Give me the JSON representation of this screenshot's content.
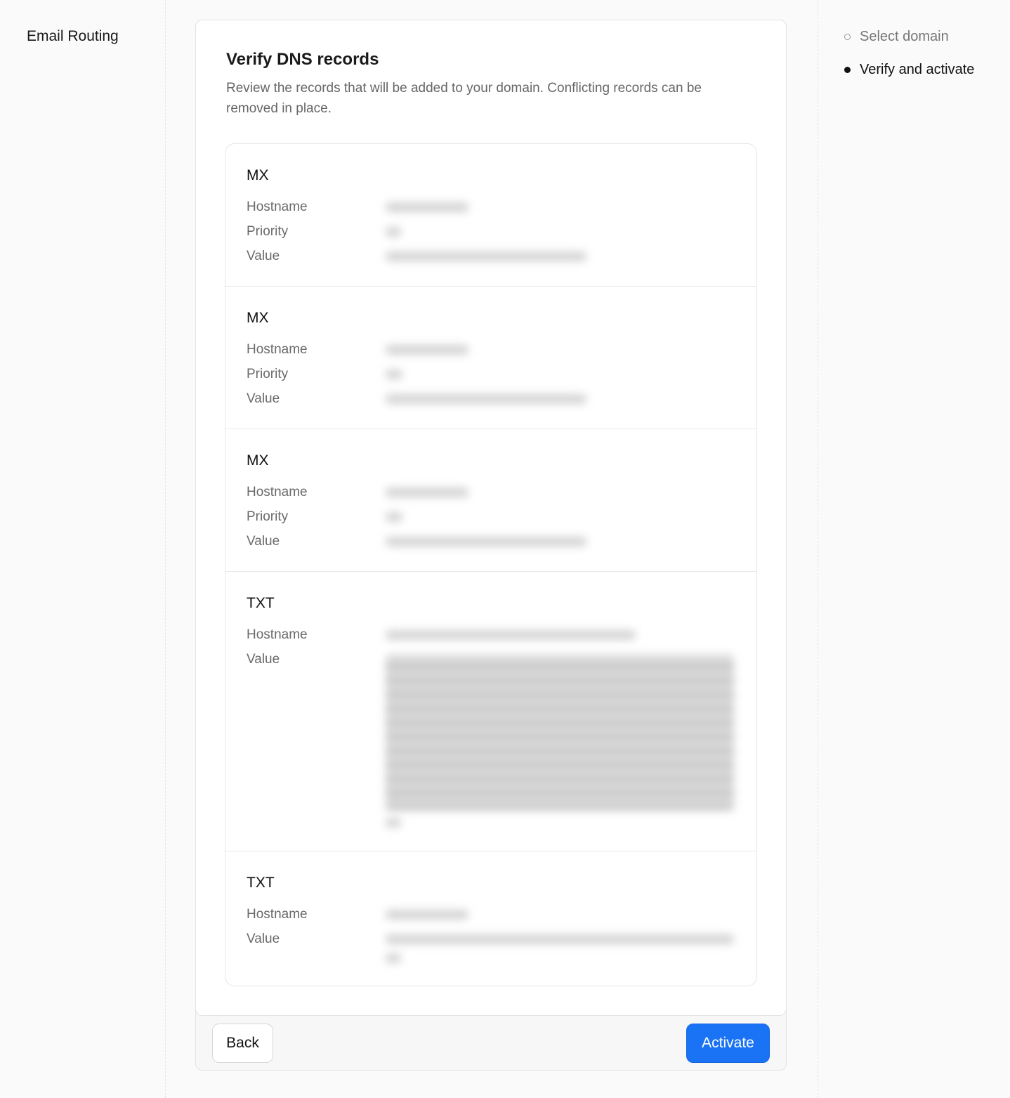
{
  "app": {
    "title": "Email Routing"
  },
  "steps": [
    {
      "label": "Select domain",
      "state": "inactive"
    },
    {
      "label": "Verify and activate",
      "state": "active"
    }
  ],
  "card": {
    "title": "Verify DNS records",
    "description": "Review the records that will be added to your domain. Conflicting records can be removed in place."
  },
  "records": [
    {
      "type": "MX",
      "fields": [
        "Hostname",
        "Priority",
        "Value"
      ],
      "values_redacted": true
    },
    {
      "type": "MX",
      "fields": [
        "Hostname",
        "Priority",
        "Value"
      ],
      "values_redacted": true
    },
    {
      "type": "MX",
      "fields": [
        "Hostname",
        "Priority",
        "Value"
      ],
      "values_redacted": true
    },
    {
      "type": "TXT",
      "fields": [
        "Hostname",
        "Value"
      ],
      "values_redacted": true
    },
    {
      "type": "TXT",
      "fields": [
        "Hostname",
        "Value"
      ],
      "values_redacted": true
    }
  ],
  "footer": {
    "back_label": "Back",
    "activate_label": "Activate"
  },
  "colors": {
    "accent": "#1a73f5",
    "page_bg": "#fafafa",
    "muted_text": "#666666"
  }
}
